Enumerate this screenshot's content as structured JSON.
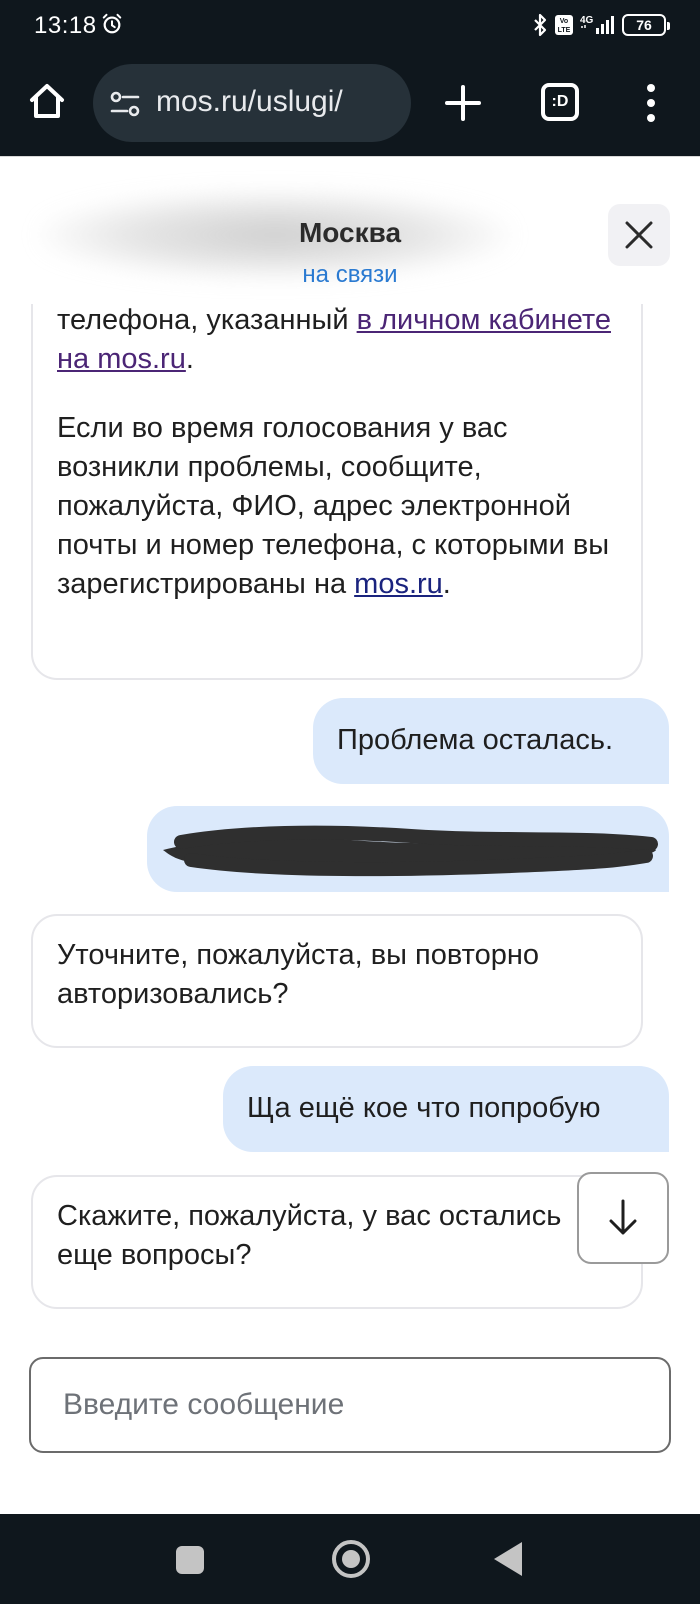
{
  "status_bar": {
    "time": "13:18",
    "network": "4G",
    "volte": "Vo LTE",
    "battery": "76"
  },
  "browser": {
    "url": "mos.ru/uslugi/",
    "tabs_label": ":D"
  },
  "chat_header": {
    "title": "Москва",
    "status": "на связи"
  },
  "messages": {
    "bot_1": {
      "line_start": "телефона, указанный ",
      "link_text": "в личном кабинете на mos.ru",
      "line_end": ".",
      "para2_text": "Если во время голосования у вас возникли проблемы, сообщите, пожалуйста, ФИО, адрес электронной почты и номер телефона, с которыми вы зарегистрированы на ",
      "para2_link": "mos.ru",
      "para2_end": "."
    },
    "user_1": "Проблема осталась.",
    "bot_2": "Уточните, пожалуйста, вы повторно авторизовались?",
    "user_2": "Ща ещё кое что попробую",
    "bot_3": "Скажите, пожалуйста, у вас остались еще вопросы?"
  },
  "input": {
    "placeholder": "Введите сообщение"
  },
  "colors": {
    "user_bubble": "#dbe9fb",
    "status_link": "#2a7ad1",
    "dark_bar": "#0f171d"
  }
}
